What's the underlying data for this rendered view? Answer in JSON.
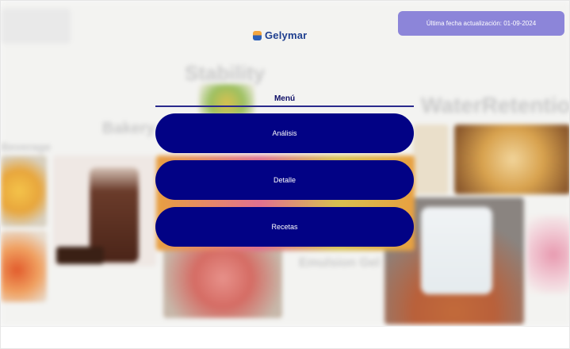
{
  "brand": {
    "logo_icon": "gelymar-logo-icon",
    "name": "Gelymar"
  },
  "update_badge": {
    "text": "Última fecha actualización: 01-09-2024"
  },
  "menu": {
    "title": "Menú",
    "items": [
      {
        "label": "Análisis"
      },
      {
        "label": "Detalle"
      },
      {
        "label": "Recetas"
      }
    ]
  },
  "background": {
    "words": [
      "Stability",
      "WaterRetention",
      "Bakery",
      "Beverage",
      "Emulsion Gel"
    ]
  },
  "colors": {
    "menu_button": "#020285",
    "badge": "#8c85d9",
    "logo_text": "#1f3f8f"
  }
}
